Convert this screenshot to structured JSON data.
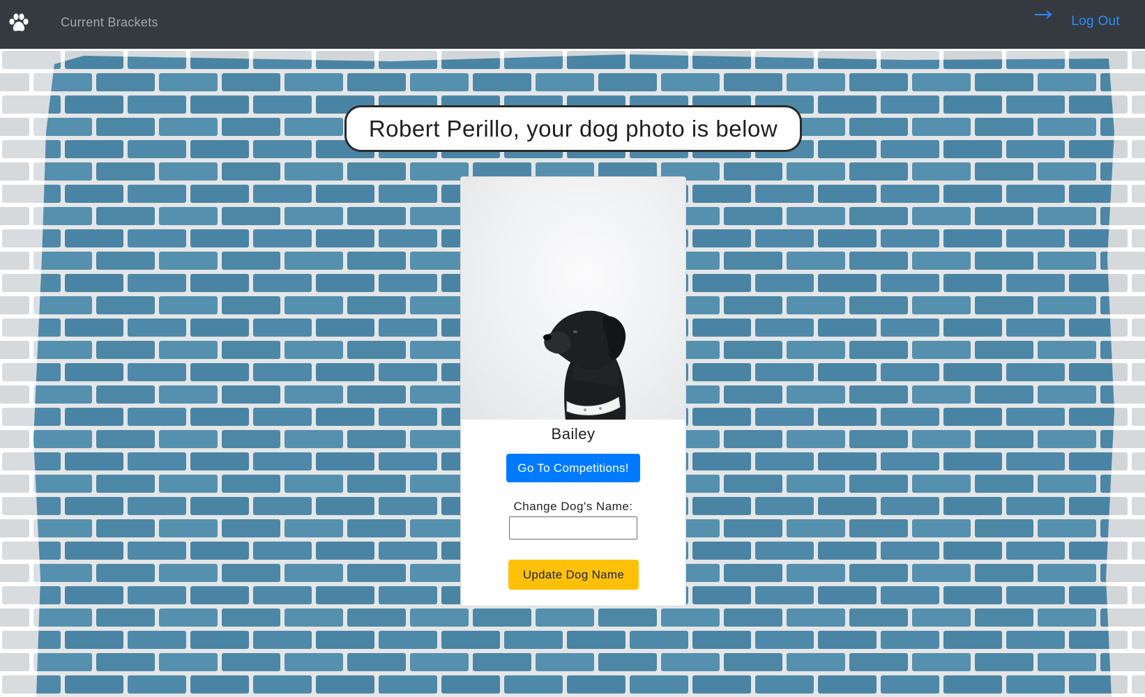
{
  "navbar": {
    "brand_icon": "paw-icon",
    "link_current_brackets": "Current Brackets",
    "logout_icon": "arrow-right-icon",
    "logout_label": "Log Out"
  },
  "heading": {
    "text": "Robert Perillo, your dog photo is below"
  },
  "dog_card": {
    "photo_alt": "dog photo",
    "dog_name": "Bailey",
    "competitions_button": "Go To Competitions!",
    "change_name_label": "Change Dog's Name:",
    "name_input_value": "",
    "name_input_placeholder": "",
    "update_button": "Update Dog Name"
  },
  "colors": {
    "navbar_bg": "#343a40",
    "accent_blue": "#007bff",
    "accent_yellow": "#ffc107",
    "wall_blue": "#4d87a7",
    "logout_blue": "#2a8cff"
  }
}
